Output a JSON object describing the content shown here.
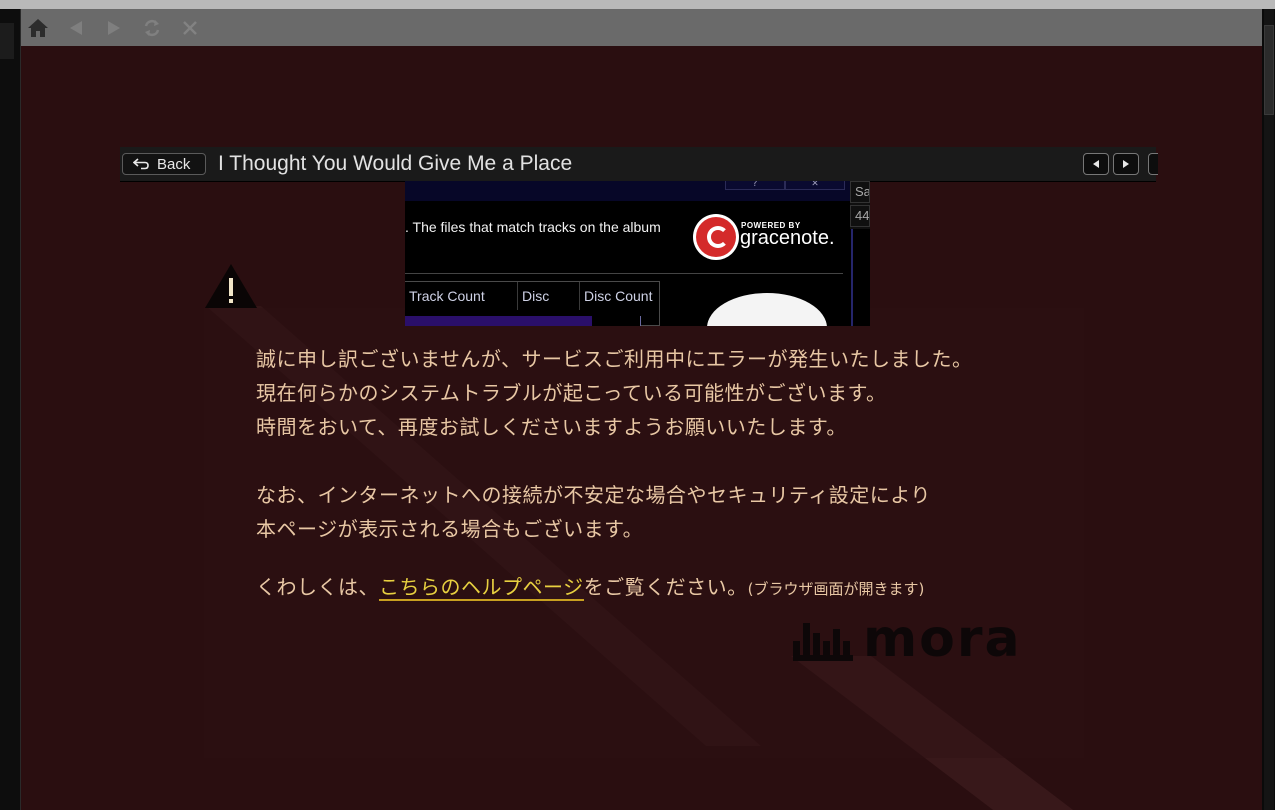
{
  "navbar": {
    "home_icon": "home-icon",
    "back_icon": "back-arrow-icon",
    "forward_icon": "forward-arrow-icon",
    "refresh_icon": "refresh-icon",
    "stop_icon": "close-icon"
  },
  "booklet": {
    "back_label": "Back",
    "title": "I Thought You Would Give Me a Place"
  },
  "embedded_screenshot": {
    "body_text": ". The files that match tracks on the album",
    "gracenote_powered": "POWERED BY",
    "gracenote_name": "gracenote.",
    "table_headers": [
      "Track Count",
      "Disc",
      "Disc Count"
    ],
    "side_cells": [
      "Sa",
      "44"
    ],
    "title_controls": [
      "?",
      "✕"
    ]
  },
  "error": {
    "line1": "誠に申し訳ございませんが、サービスご利用中にエラーが発生いたしました。",
    "line2": "現在何らかのシステムトラブルが起こっている可能性がございます。",
    "line3": "時間をおいて、再度お試しくださいますようお願いいたします。",
    "line4": "なお、インターネットへの接続が不安定な場合やセキュリティ設定により",
    "line5": "本ページが表示される場合もございます。",
    "help_prefix": "くわしくは、",
    "help_link": "こちらのヘルプページ",
    "help_suffix": "をご覧ください。",
    "help_note": "(ブラウザ画面が開きます)"
  },
  "brand": {
    "logo_text": "mora"
  },
  "colors": {
    "background": "#2a0e10",
    "message_text": "#e8c7a4",
    "link_text": "#e8d040",
    "navbar": "#6a6a6a"
  }
}
